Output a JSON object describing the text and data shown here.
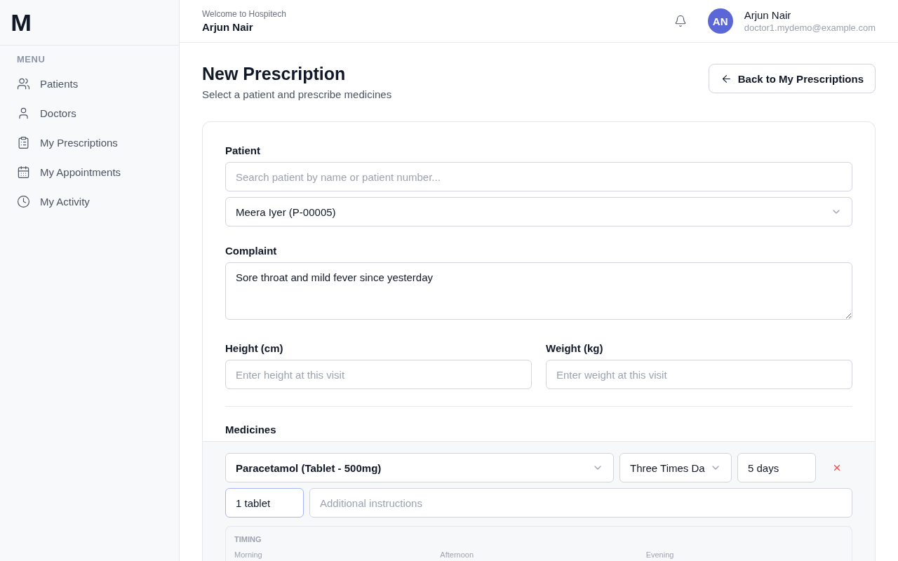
{
  "logo": "M",
  "sidebar": {
    "section": "MENU",
    "items": [
      {
        "label": "Patients",
        "selected": false
      },
      {
        "label": "Doctors",
        "selected": false
      },
      {
        "label": "My Prescriptions",
        "selected": false
      },
      {
        "label": "My Appointments",
        "selected": false
      },
      {
        "label": "My Activity",
        "selected": false
      }
    ]
  },
  "header": {
    "welcome": "Welcome to Hospitech",
    "name": "Arjun Nair",
    "avatar": "AN",
    "user_name": "Arjun Nair",
    "email": "doctor1.mydemo@example.com"
  },
  "page": {
    "title": "New Prescription",
    "subtitle": "Select a patient and prescribe medicines",
    "back_button": "Back to My Prescriptions"
  },
  "form": {
    "patient_label": "Patient",
    "patient_search": {
      "placeholder": "Search patient by name or patient number..."
    },
    "patient_select": "Meera Iyer (P-00005)",
    "complaint_label": "Complaint",
    "complaint": "Sore throat and mild fever since yesterday",
    "height_label": "Height (cm)",
    "height": {
      "placeholder": "Enter height at this visit"
    },
    "weight_label": "Weight (kg)",
    "weight": {
      "placeholder": "Enter weight at this visit"
    },
    "medicines_label": "Medicines",
    "medicines": [
      {
        "medicine": "Paracetamol (Tablet - 500mg)",
        "frequency": "Three Times Da",
        "duration": "5 days",
        "dose": "1 tablet",
        "dose_focused": true,
        "instructions": {
          "placeholder": "Additional instructions"
        },
        "timing_label": "TIMING",
        "timings": [
          "Morning",
          "Afternoon",
          "Evening"
        ]
      }
    ]
  }
}
